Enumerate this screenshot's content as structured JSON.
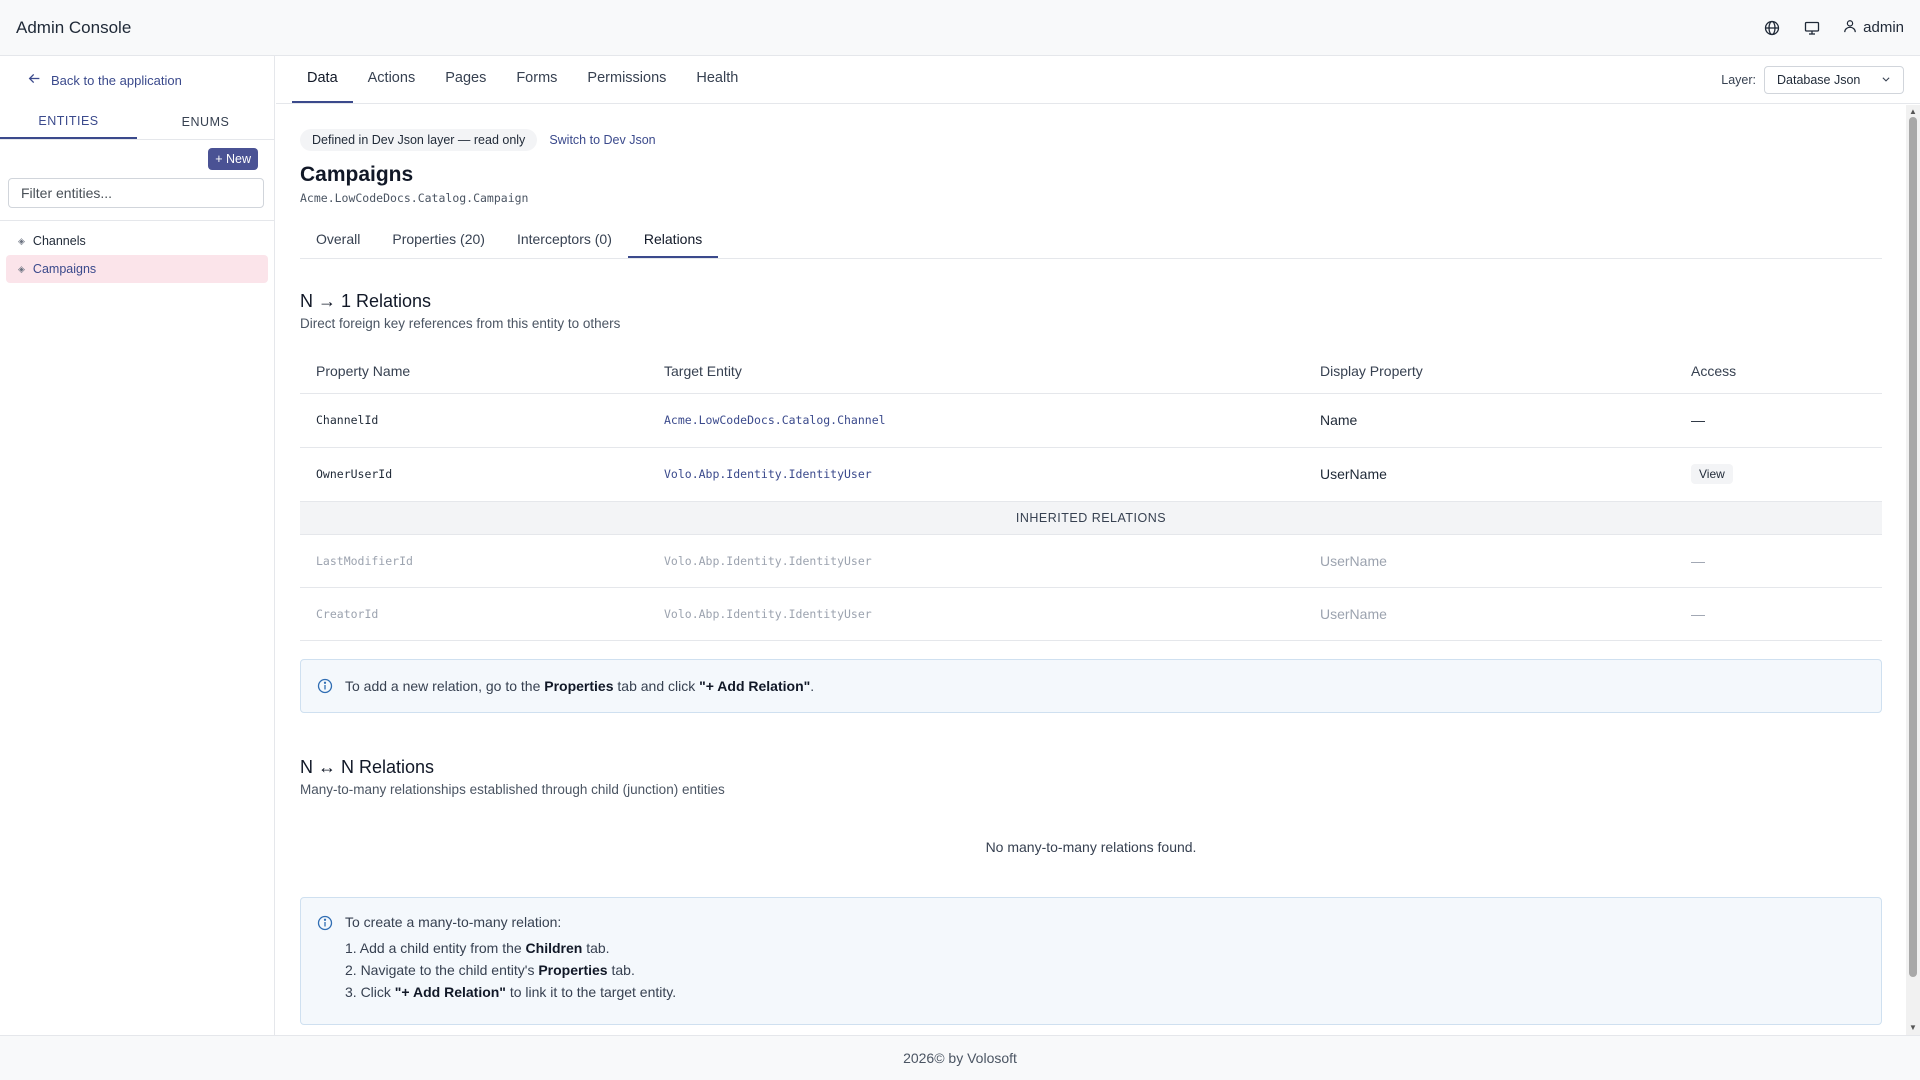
{
  "app": {
    "title": "Admin Console"
  },
  "header": {
    "user": "admin"
  },
  "sidebar": {
    "back_label": "Back to the application",
    "tabs": [
      "ENTITIES",
      "ENUMS"
    ],
    "new_label": "+ New",
    "filter_placeholder": "Filter entities...",
    "entities": [
      {
        "label": "Channels",
        "active": false
      },
      {
        "label": "Campaigns",
        "active": true
      }
    ]
  },
  "nav": {
    "tabs": [
      "Data",
      "Actions",
      "Pages",
      "Forms",
      "Permissions",
      "Health"
    ],
    "active": "Data",
    "layer_label": "Layer:",
    "layer_value": "Database Json"
  },
  "entity": {
    "readonly_badge": "Defined in Dev Json layer — read only",
    "switch_link": "Switch to Dev Json",
    "title": "Campaigns",
    "namespace": "Acme.LowCodeDocs.Catalog.Campaign",
    "subtabs": [
      "Overall",
      "Properties (20)",
      "Interceptors (0)",
      "Relations"
    ],
    "active_subtab": "Relations"
  },
  "n1": {
    "title": "N → 1 Relations",
    "description": "Direct foreign key references from this entity to others",
    "columns": [
      "Property Name",
      "Target Entity",
      "Display Property",
      "Access"
    ],
    "rows": [
      {
        "property": "ChannelId",
        "target": "Acme.LowCodeDocs.Catalog.Channel",
        "display": "Name",
        "access": "—"
      },
      {
        "property": "OwnerUserId",
        "target": "Volo.Abp.Identity.IdentityUser",
        "display": "UserName",
        "access": "View"
      }
    ],
    "inherited_label": "INHERITED RELATIONS",
    "inherited": [
      {
        "property": "LastModifierId",
        "target": "Volo.Abp.Identity.IdentityUser",
        "display": "UserName",
        "access": "—"
      },
      {
        "property": "CreatorId",
        "target": "Volo.Abp.Identity.IdentityUser",
        "display": "UserName",
        "access": "—"
      }
    ],
    "info": {
      "pre": "To add a new relation, go to the ",
      "b1": "Properties",
      "mid": " tab and click ",
      "b2": "\"+ Add Relation\"",
      "post": "."
    }
  },
  "nn": {
    "title": "N ↔ N Relations",
    "description": "Many-to-many relationships established through child (junction) entities",
    "empty": "No many-to-many relations found.",
    "info": {
      "intro": "To create a many-to-many relation:",
      "s1_pre": "1. Add a child entity from the ",
      "s1_b": "Children",
      "s1_post": " tab.",
      "s2_pre": "2. Navigate to the child entity's ",
      "s2_b": "Properties",
      "s2_post": " tab.",
      "s3_pre": "3. Click ",
      "s3_b": "\"+ Add Relation\"",
      "s3_post": " to link it to the target entity."
    }
  },
  "footer": {
    "text": "2026© by Volosoft"
  }
}
